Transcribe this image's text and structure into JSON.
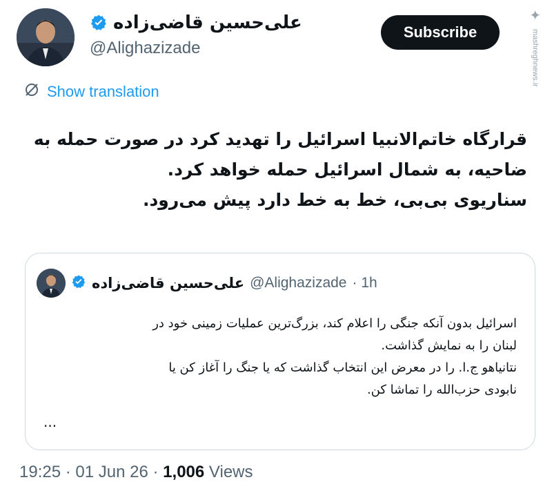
{
  "author": {
    "display_name": "علی‌حسین قاضی‌زاده",
    "handle": "@Alighazizade"
  },
  "subscribe_label": "Subscribe",
  "watermark": {
    "logo": "✦",
    "text": "mashreghnews.ir"
  },
  "translation": {
    "label": "Show translation",
    "icon": "globe-slash-icon"
  },
  "tweet_lines": [
    "قرارگاه خاتم‌الانبیا اسرائیل را تهدید کرد در صورت حمله به",
    "ضاحیه، به شمال اسرائیل حمله خواهد کرد.",
    "سناریوی بی‌بی، خط به خط دارد پیش می‌رود."
  ],
  "quoted": {
    "display_name": "علی‌حسین قاضی‌زاده",
    "handle": "@Alighazizade",
    "time": "· 1h",
    "lines": [
      "اسرائیل بدون آنکه جنگی را اعلام کند، بزرگ‌ترین عملیات زمینی خود در",
      "لبنان را به نمایش گذاشت.",
      "نتانیاهو ج.ا. را در معرض این انتخاب گذاشت که یا جنگ را آغاز کن یا",
      "نابودی حزب‌الله را تماشا کن."
    ],
    "more": "..."
  },
  "meta": {
    "time": "19:25",
    "date": "01 Jun 26",
    "separator": "·",
    "views_count": "1,006",
    "views_label": "Views"
  },
  "colors": {
    "accent": "#1d9bf0",
    "text": "#0f1419",
    "muted": "#536471",
    "border": "#cfd9de"
  }
}
